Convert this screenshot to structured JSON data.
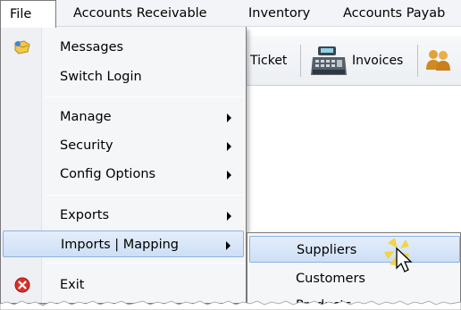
{
  "menubar": {
    "items": [
      {
        "label": "File"
      },
      {
        "label": "Accounts Receivable"
      },
      {
        "label": "Inventory"
      },
      {
        "label": "Accounts Payab"
      }
    ]
  },
  "toolbar": {
    "ticket_label": "Ticket",
    "invoices_label": "Invoices"
  },
  "file_menu": {
    "items": [
      {
        "label": "Messages",
        "icon": "messages-icon"
      },
      {
        "label": "Switch Login"
      },
      {
        "label": "Manage",
        "submenu": true
      },
      {
        "label": "Security",
        "submenu": true
      },
      {
        "label": "Config Options",
        "submenu": true
      },
      {
        "label": "Exports",
        "submenu": true
      },
      {
        "label": "Imports | Mapping",
        "submenu": true,
        "highlighted": true
      },
      {
        "label": "Exit",
        "icon": "exit-icon"
      }
    ]
  },
  "imports_submenu": {
    "items": [
      {
        "label": "Suppliers",
        "highlighted": true
      },
      {
        "label": "Customers"
      },
      {
        "label": "Products"
      }
    ]
  },
  "colors": {
    "highlight_bg": "#cddff6",
    "highlight_border": "#8cb2e3",
    "exit_icon": "#d9302a"
  }
}
